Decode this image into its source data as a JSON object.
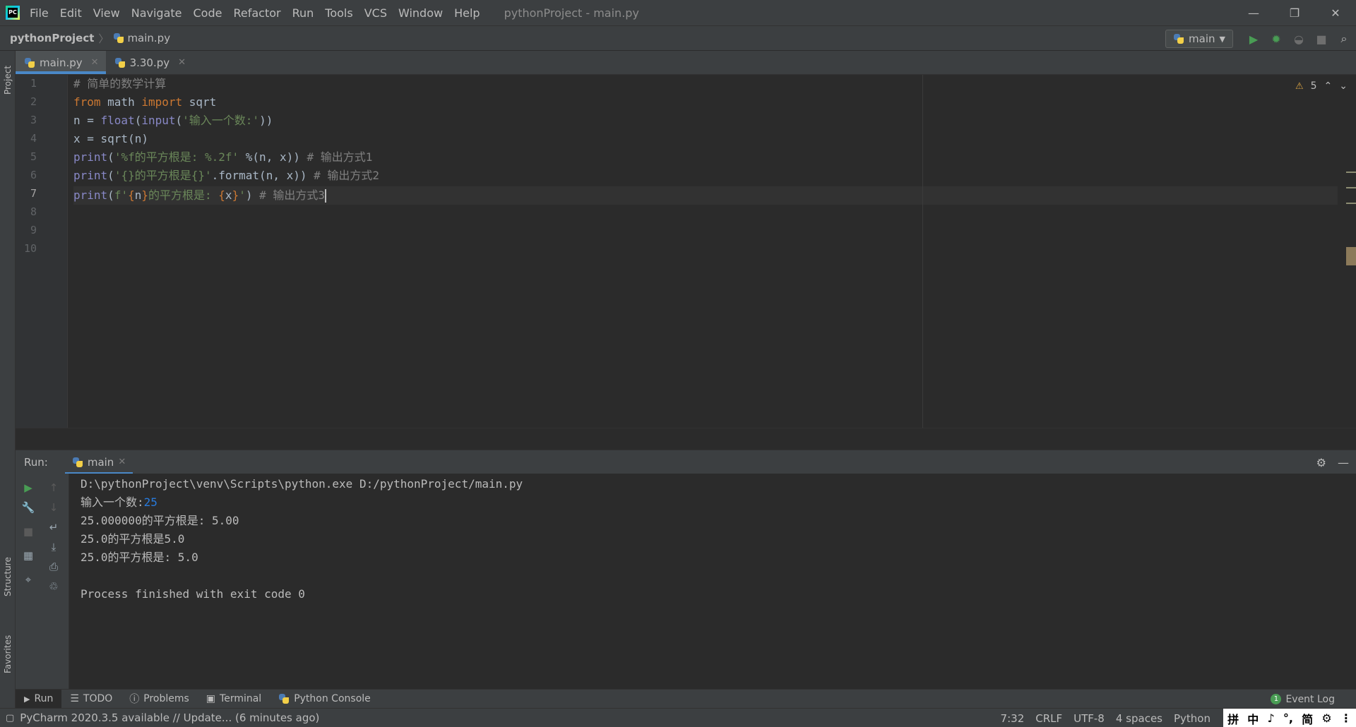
{
  "menubar": {
    "items": [
      "File",
      "Edit",
      "View",
      "Navigate",
      "Code",
      "Refactor",
      "Run",
      "Tools",
      "VCS",
      "Window",
      "Help"
    ],
    "window_title": "pythonProject - main.py"
  },
  "navbar": {
    "project": "pythonProject",
    "file": "main.py",
    "run_config": "main"
  },
  "left_strip": {
    "project_label": "Project",
    "structure_label": "Structure",
    "favorites_label": "Favorites"
  },
  "editor_tabs": [
    {
      "label": "main.py",
      "active": true
    },
    {
      "label": "3.30.py",
      "active": false
    }
  ],
  "editor": {
    "warnings_count": "5",
    "line_numbers": [
      "1",
      "2",
      "3",
      "4",
      "5",
      "6",
      "7",
      "8",
      "9",
      "10"
    ],
    "current_line": "7",
    "lines": {
      "l1": "# 简单的数学计算",
      "l2_from": "from",
      "l2_mod": " math ",
      "l2_import": "import",
      "l2_rest": " sqrt",
      "l3_a": "n = ",
      "l3_float": "float",
      "l3_b": "(",
      "l3_input": "input",
      "l3_c": "(",
      "l3_str": "'输入一个数:'",
      "l3_d": "))",
      "l4": "x = sqrt(n)",
      "l5_print": "print",
      "l5_a": "(",
      "l5_str": "'%f的平方根是: %.2f'",
      "l5_b": " %(n, x))",
      "l5_cmt": " # 输出方式1",
      "l6_print": "print",
      "l6_a": "(",
      "l6_str": "'{}的平方根是{}'",
      "l6_b": ".format(n, x))",
      "l6_cmt": " # 输出方式2",
      "l7_print": "print",
      "l7_a": "(",
      "l7_str1": "f'",
      "l7_brace1": "{",
      "l7_var1": "n",
      "l7_brace2": "}",
      "l7_str2": "的平方根是: ",
      "l7_brace3": "{",
      "l7_var2": "x",
      "l7_brace4": "}",
      "l7_str3": "'",
      "l7_b": ")",
      "l7_cmt": " # 输出方式3"
    }
  },
  "run_panel": {
    "label": "Run:",
    "tab": "main",
    "console": {
      "cmd": "D:\\pythonProject\\venv\\Scripts\\python.exe D:/pythonProject/main.py",
      "prompt": "输入一个数:",
      "user_input": "25",
      "out1": "25.000000的平方根是: 5.00",
      "out2": "25.0的平方根是5.0",
      "out3": "25.0的平方根是: 5.0",
      "exit": "Process finished with exit code 0"
    }
  },
  "toolwindows": {
    "run": "Run",
    "todo": "TODO",
    "problems": "Problems",
    "terminal": "Terminal",
    "python_console": "Python Console",
    "event_log": "Event Log",
    "event_log_count": "1"
  },
  "statusbar": {
    "message": "PyCharm 2020.3.5 available // Update... (6 minutes ago)",
    "position": "7:32",
    "line_sep": "CRLF",
    "encoding": "UTF-8",
    "indent": "4 spaces",
    "interpreter": "Python"
  },
  "ime": [
    "拼",
    "中",
    "♪",
    "°,",
    "简",
    "⚙",
    "⋮"
  ],
  "colors": {
    "keyword": "#cc7832",
    "string": "#6a8759",
    "builtin": "#8888c6",
    "comment": "#808080",
    "accent": "#4a88c7",
    "run_green": "#499c54"
  }
}
